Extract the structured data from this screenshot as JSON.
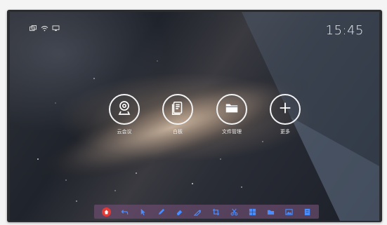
{
  "clock": {
    "time": "15:45"
  },
  "status_bar": {
    "icons": [
      "screen-mirror-icon",
      "wifi-icon",
      "display-icon"
    ]
  },
  "apps": [
    {
      "label": "云会议",
      "icon": "cloud-meeting-icon"
    },
    {
      "label": "白板",
      "icon": "whiteboard-icon"
    },
    {
      "label": "文件管理",
      "icon": "folder-icon"
    },
    {
      "label": "更多",
      "icon": "plus-icon"
    }
  ],
  "toolbar": {
    "tools": [
      "home-icon",
      "undo-icon",
      "pointer-icon",
      "pen-icon",
      "eraser-icon",
      "highlighter-icon",
      "crop-icon",
      "scissors-icon",
      "grid-icon",
      "folder-icon",
      "image-icon",
      "note-icon"
    ]
  },
  "colors": {
    "accent_home": "#e53935",
    "toolbar_bg": "#694b6e",
    "icon_color": "#4a8dff"
  }
}
